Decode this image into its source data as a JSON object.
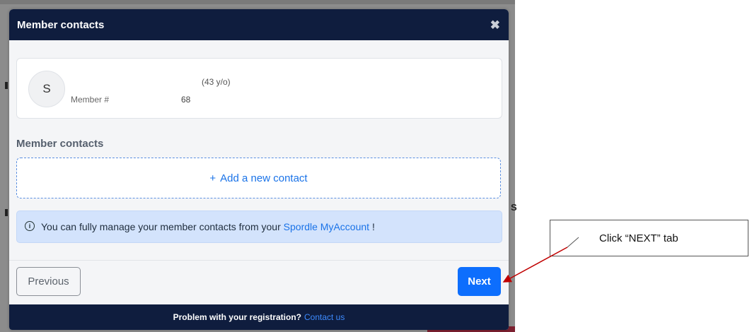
{
  "modal": {
    "title": "Member contacts",
    "member": {
      "avatar_initial": "S",
      "age": "(43 y/o)",
      "member_label": "Member #",
      "member_number": "68"
    },
    "section_title": "Member contacts",
    "add_contact": {
      "icon": "+",
      "label": "Add a new contact"
    },
    "info": {
      "icon": "i",
      "text_before": "You can fully manage your member contacts from your",
      "link": "Spordle MyAccount",
      "text_after": "!"
    },
    "buttons": {
      "previous": "Previous",
      "next": "Next"
    },
    "footer": {
      "text": "Problem with your registration?",
      "link": "Contact us"
    }
  },
  "annotation": {
    "callout_text": "Click “NEXT” tab",
    "arrow_color": "#c00000"
  },
  "colors": {
    "header_bg": "#0f1d3e",
    "primary": "#0d6efd",
    "link": "#1a73e8",
    "info_bg": "#d3e3fc"
  },
  "background": {
    "partial_text": "S"
  }
}
